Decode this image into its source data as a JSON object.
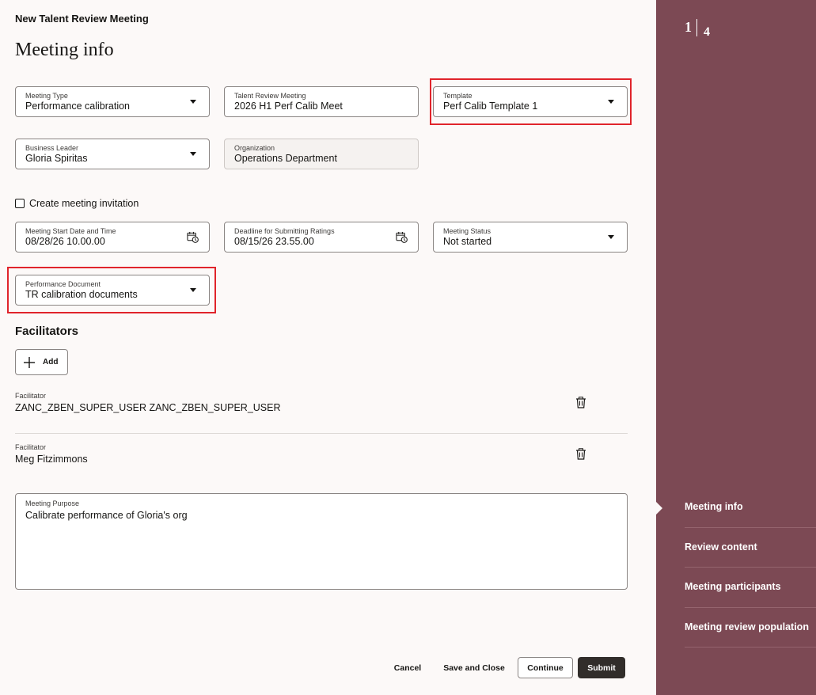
{
  "header": {
    "breadcrumb": "New Talent Review Meeting",
    "page_title": "Meeting info"
  },
  "form": {
    "meeting_type": {
      "label": "Meeting Type",
      "value": "Performance calibration"
    },
    "talent_review_meeting": {
      "label": "Talent Review Meeting",
      "value": "2026 H1 Perf Calib Meet"
    },
    "template": {
      "label": "Template",
      "value": "Perf Calib Template 1"
    },
    "business_leader": {
      "label": "Business Leader",
      "value": "Gloria Spiritas"
    },
    "organization": {
      "label": "Organization",
      "value": "Operations Department"
    },
    "create_invitation": {
      "label": "Create meeting invitation",
      "checked": false
    },
    "start_date": {
      "label": "Meeting Start Date and Time",
      "value": "08/28/26 10.00.00"
    },
    "deadline": {
      "label": "Deadline for Submitting Ratings",
      "value": "08/15/26 23.55.00"
    },
    "meeting_status": {
      "label": "Meeting Status",
      "value": "Not started"
    },
    "performance_document": {
      "label": "Performance Document",
      "value": "TR calibration documents"
    },
    "meeting_purpose": {
      "label": "Meeting Purpose",
      "value": "Calibrate performance of Gloria's org"
    }
  },
  "facilitators": {
    "heading": "Facilitators",
    "add_label": "Add",
    "items": [
      {
        "label": "Facilitator",
        "value": "ZANC_ZBEN_SUPER_USER ZANC_ZBEN_SUPER_USER"
      },
      {
        "label": "Facilitator",
        "value": "Meg Fitzimmons"
      }
    ]
  },
  "footer": {
    "cancel": "Cancel",
    "save_close": "Save and Close",
    "continue": "Continue",
    "submit": "Submit"
  },
  "sidebar": {
    "step_current": "1",
    "step_total": "4",
    "steps": [
      {
        "label": "Meeting info",
        "active": true
      },
      {
        "label": "Review content",
        "active": false
      },
      {
        "label": "Meeting participants",
        "active": false
      },
      {
        "label": "Meeting review population",
        "active": false
      }
    ]
  },
  "colors": {
    "sidebar_bg": "#7c4954",
    "page_bg": "#fcf9f8",
    "highlight": "#e0242b",
    "primary_button": "#312d2a"
  }
}
